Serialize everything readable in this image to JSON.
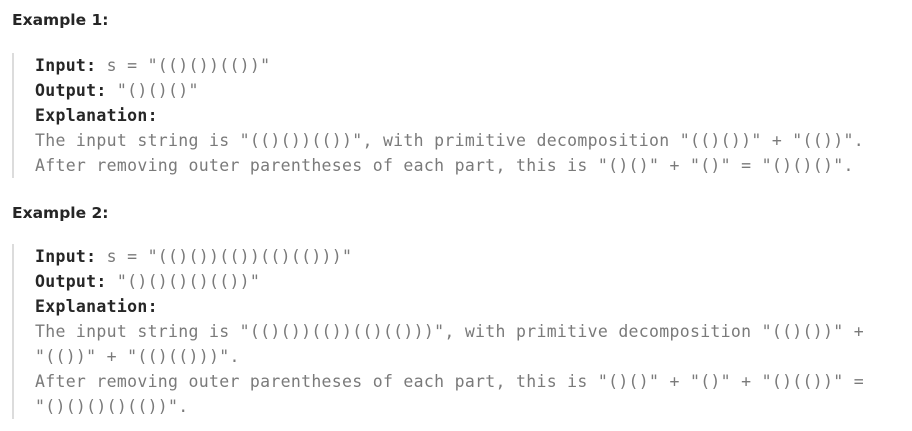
{
  "examples": [
    {
      "title": "Example 1:",
      "input_label": "Input:",
      "input_value": " s = \"(()())(())\"",
      "output_label": "Output:",
      "output_value": " \"()()()\"",
      "explanation_label": "Explanation:",
      "explanation_lines": [
        "The input string is \"(()())(())\", with primitive decomposition \"(()())\" + \"(())\".",
        "After removing outer parentheses of each part, this is \"()()\" + \"()\" = \"()()()\"."
      ]
    },
    {
      "title": "Example 2:",
      "input_label": "Input:",
      "input_value": " s = \"(()())(())(()(()))\"",
      "output_label": "Output:",
      "output_value": " \"()()()()(())\"",
      "explanation_label": "Explanation:",
      "explanation_lines": [
        "The input string is \"(()())(())(()(()))\", with primitive decomposition \"(()())\" +",
        "\"(())\" + \"(()(()))\".",
        "After removing outer parentheses of each part, this is \"()()\" + \"()\" + \"()(())\" =",
        "\"()()()()(())\"."
      ]
    }
  ]
}
